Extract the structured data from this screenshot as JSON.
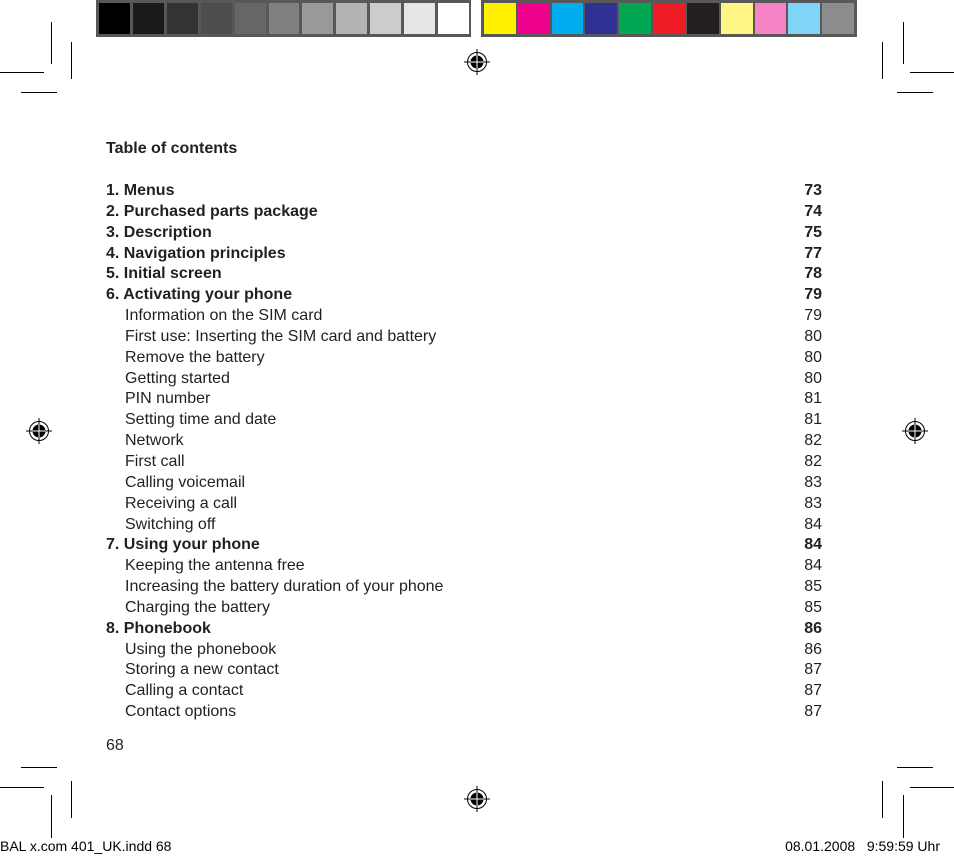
{
  "color_bar": {
    "grayscale": [
      "#000000",
      "#1a1a1a",
      "#333333",
      "#4d4d4d",
      "#666666",
      "#808080",
      "#999999",
      "#b3b3b3",
      "#cccccc",
      "#e6e6e6",
      "#ffffff"
    ],
    "process": [
      "#fff200",
      "#ec008c",
      "#00aeef",
      "#2e3192",
      "#00a651",
      "#ed1c24",
      "#231f20",
      "#fff685",
      "#f583c6",
      "#7fd5f7",
      "#8d8c8c"
    ]
  },
  "toc": {
    "title": "Table of contents",
    "entries": [
      {
        "label": "1. Menus",
        "page": "73",
        "level": "main"
      },
      {
        "label": "2. Purchased parts package",
        "page": "74",
        "level": "main"
      },
      {
        "label": "3. Description",
        "page": "75",
        "level": "main"
      },
      {
        "label": "4. Navigation principles",
        "page": "77",
        "level": "main"
      },
      {
        "label": "5. Initial screen",
        "page": "78",
        "level": "main"
      },
      {
        "label": "6. Activating your phone",
        "page": "79",
        "level": "main"
      },
      {
        "label": "Information on the SIM card",
        "page": "79",
        "level": "sub"
      },
      {
        "label": "First use: Inserting the SIM card and battery",
        "page": "80",
        "level": "sub"
      },
      {
        "label": "Remove the battery",
        "page": "80",
        "level": "sub"
      },
      {
        "label": "Getting started",
        "page": "80",
        "level": "sub"
      },
      {
        "label": "PIN number",
        "page": "81",
        "level": "sub"
      },
      {
        "label": "Setting time and date",
        "page": "81",
        "level": "sub"
      },
      {
        "label": "Network",
        "page": "82",
        "level": "sub"
      },
      {
        "label": "First call",
        "page": "82",
        "level": "sub"
      },
      {
        "label": "Calling voicemail",
        "page": "83",
        "level": "sub"
      },
      {
        "label": "Receiving a call",
        "page": "83",
        "level": "sub"
      },
      {
        "label": "Switching off",
        "page": "84",
        "level": "sub"
      },
      {
        "label": "7. Using your phone",
        "page": "84",
        "level": "main"
      },
      {
        "label": "Keeping the antenna free",
        "page": "84",
        "level": "sub"
      },
      {
        "label": "Increasing the battery duration of your phone",
        "page": "85",
        "level": "sub"
      },
      {
        "label": "Charging the battery",
        "page": "85",
        "level": "sub"
      },
      {
        "label": "8. Phonebook",
        "page": "86",
        "level": "main"
      },
      {
        "label": "Using the phonebook",
        "page": "86",
        "level": "sub"
      },
      {
        "label": "Storing a new contact",
        "page": "87",
        "level": "sub"
      },
      {
        "label": "Calling a contact",
        "page": "87",
        "level": "sub"
      },
      {
        "label": "Contact options",
        "page": "87",
        "level": "sub"
      }
    ]
  },
  "page_number": "68",
  "slug": {
    "file": "BAL x.com 401_UK.indd   68",
    "date": "08.01.2008",
    "time": "9:59:59 Uhr"
  }
}
